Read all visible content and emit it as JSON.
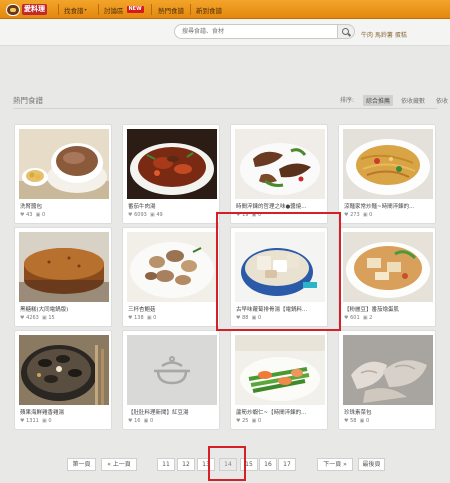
{
  "header": {
    "logo_text": "愛料理",
    "nav": [
      {
        "label": "找食譜",
        "caret": "▾"
      },
      {
        "label": "討論區",
        "badge": "NEW"
      },
      {
        "label": "熱門食譜"
      },
      {
        "label": "新到食譜"
      }
    ]
  },
  "search": {
    "placeholder": "搜尋食譜、食材",
    "hot_keywords": "牛肉 馬鈴薯 蛋糕"
  },
  "section": {
    "title": "熱門食譜",
    "sort_label": "排序:",
    "sort_options": [
      "綜合推薦",
      "依收藏數",
      "依收藏數"
    ],
    "active_sort": "綜合推薦"
  },
  "recipes": [
    {
      "title": "洗腎醬包",
      "likes": "43",
      "photos": "0",
      "highlighted": false
    },
    {
      "title": "番茄牛肉湯",
      "likes": "6093",
      "photos": "49",
      "highlighted": false
    },
    {
      "title": "時間淬鍊的哲理之味●醬燒...",
      "likes": "19",
      "photos": "0",
      "highlighted": false
    },
    {
      "title": "涼麵家常炒麵~時間淬鍊的...",
      "likes": "273",
      "photos": "0",
      "highlighted": false
    },
    {
      "title": "黑糖糕(大同電鍋版)",
      "likes": "4263",
      "photos": "15",
      "highlighted": false
    },
    {
      "title": "三杯杏鮑菇",
      "likes": "138",
      "photos": "0",
      "highlighted": false
    },
    {
      "title": "古早味蘿蔔排骨湯【電鍋料...",
      "likes": "88",
      "photos": "0",
      "highlighted": true
    },
    {
      "title": "【粉麗豆】番茄燴蛋肌",
      "likes": "601",
      "photos": "2",
      "highlighted": false
    },
    {
      "title": "蘋果海鮮雞香雞湯",
      "likes": "1311",
      "photos": "0",
      "highlighted": false
    },
    {
      "title": "【肚肚料理新聞】紅豆湯",
      "likes": "16",
      "photos": "0",
      "highlighted": false
    },
    {
      "title": "蘆筍炒蝦仁~【時間淬鍊的...",
      "likes": "25",
      "photos": "0",
      "highlighted": false
    },
    {
      "title": "珍珠素菜包",
      "likes": "58",
      "photos": "0",
      "highlighted": false
    }
  ],
  "pagination": {
    "first": "第一頁",
    "prev": "« 上一頁",
    "pages": [
      "11",
      "12",
      "13",
      "14",
      "15",
      "16",
      "17"
    ],
    "current": "14",
    "next": "下一頁 »",
    "last": "最後頁"
  },
  "colors": {
    "brand_orange": "#ee9a1f",
    "highlight_red": "#d62027",
    "background": "#e8e8e6"
  }
}
